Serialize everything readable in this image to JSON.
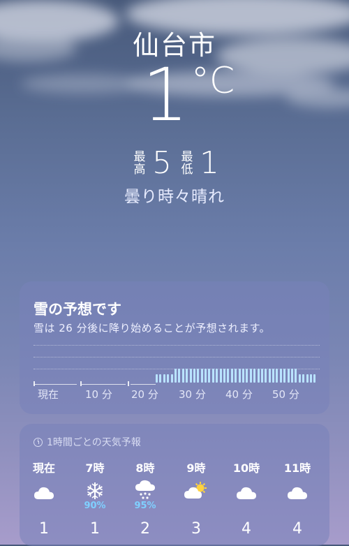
{
  "header": {
    "city": "仙台市",
    "temperature": "1",
    "unit": "°C",
    "high_label": "最高",
    "high_value": "5",
    "low_label": "最低",
    "low_value": "1",
    "condition": "曇り時々晴れ"
  },
  "snow_card": {
    "title": "雪の予想です",
    "description": "雪は 26 分後に降り始めることが予想されます。",
    "timeline_labels": [
      "現在",
      "10 分",
      "20 分",
      "30 分",
      "40 分",
      "50 分"
    ],
    "precip_start_minute": 26,
    "bar_color": "#b9e3ff"
  },
  "hourly_card": {
    "heading": "1時間ごとの天気予報",
    "heading_icon": "clock-icon",
    "hours": [
      {
        "time": "現在",
        "icon": "cloud-icon",
        "pct": "",
        "temp": "1"
      },
      {
        "time": "7時",
        "icon": "snowflake-icon",
        "pct": "90%",
        "temp": "1"
      },
      {
        "time": "8時",
        "icon": "snow-cloud-icon",
        "pct": "95%",
        "temp": "2"
      },
      {
        "time": "9時",
        "icon": "sun-behind-cloud-icon",
        "pct": "",
        "temp": "3"
      },
      {
        "time": "10時",
        "icon": "cloud-icon",
        "pct": "",
        "temp": "4"
      },
      {
        "time": "11時",
        "icon": "cloud-icon",
        "pct": "",
        "temp": "4"
      }
    ]
  },
  "colors": {
    "precip_pct": "#7fd0ff",
    "card_bg": "rgba(120,130,185,0.55)"
  }
}
